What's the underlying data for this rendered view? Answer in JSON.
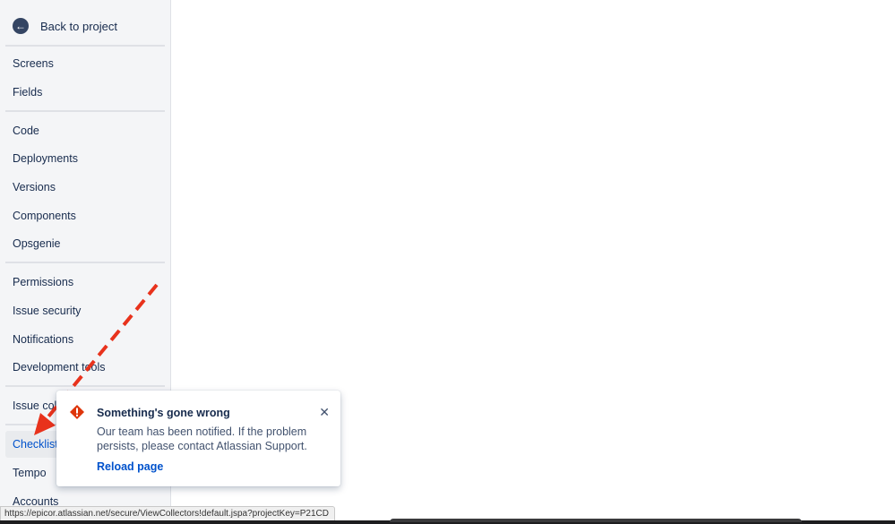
{
  "sidebar": {
    "back_label": "Back to project",
    "groups": [
      [
        "Screens",
        "Fields"
      ],
      [
        "Code",
        "Deployments",
        "Versions",
        "Components",
        "Opsgenie"
      ],
      [
        "Permissions",
        "Issue security",
        "Notifications",
        "Development tools"
      ],
      [
        "Issue collectors"
      ],
      [
        "Checklist",
        "Tempo",
        "Accounts"
      ]
    ],
    "active_item": "Checklist"
  },
  "toast": {
    "title": "Something's gone wrong",
    "body": "Our team has been notified. If the problem persists, please contact Atlassian Support.",
    "action": "Reload page",
    "icon": "error-icon",
    "close_icon": "close-icon"
  },
  "status_url": "https://epicor.atlassian.net/secure/ViewCollectors!default.jspa?projectKey=P21CD",
  "colors": {
    "sidebar_bg": "#f4f5f7",
    "link": "#0052cc",
    "error": "#de350b",
    "annotation_arrow": "#e8321c"
  }
}
